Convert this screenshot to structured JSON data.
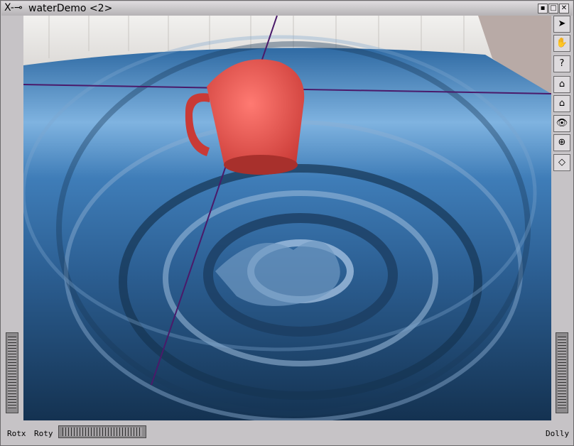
{
  "window": {
    "icon_glyphs": "X-⊸",
    "title": "waterDemo <2>",
    "controls": [
      {
        "name": "iconify-button",
        "glyph": "▪"
      },
      {
        "name": "maximize-button",
        "glyph": "□"
      },
      {
        "name": "close-button",
        "glyph": "✕"
      }
    ]
  },
  "toolbar": [
    {
      "name": "select-arrow-tool",
      "glyph": "➤"
    },
    {
      "name": "view-hand-tool",
      "glyph": "✋"
    },
    {
      "name": "help-tool",
      "glyph": "?"
    },
    {
      "name": "home-tool",
      "glyph": "⌂"
    },
    {
      "name": "set-home-tool",
      "glyph": "⌂"
    },
    {
      "name": "view-all-tool",
      "glyph": "👁"
    },
    {
      "name": "seek-tool",
      "glyph": "⊕"
    },
    {
      "name": "perspective-tool",
      "glyph": "◇"
    }
  ],
  "bottom": {
    "rotx_label": "Rotx",
    "roty_label": "Roty",
    "dolly_label": "Dolly"
  },
  "colors": {
    "mug": "#e8504c",
    "water": "#3a78b0",
    "axis_lines": "#4a1a6a",
    "tile_wall": "#e8e6e4"
  }
}
